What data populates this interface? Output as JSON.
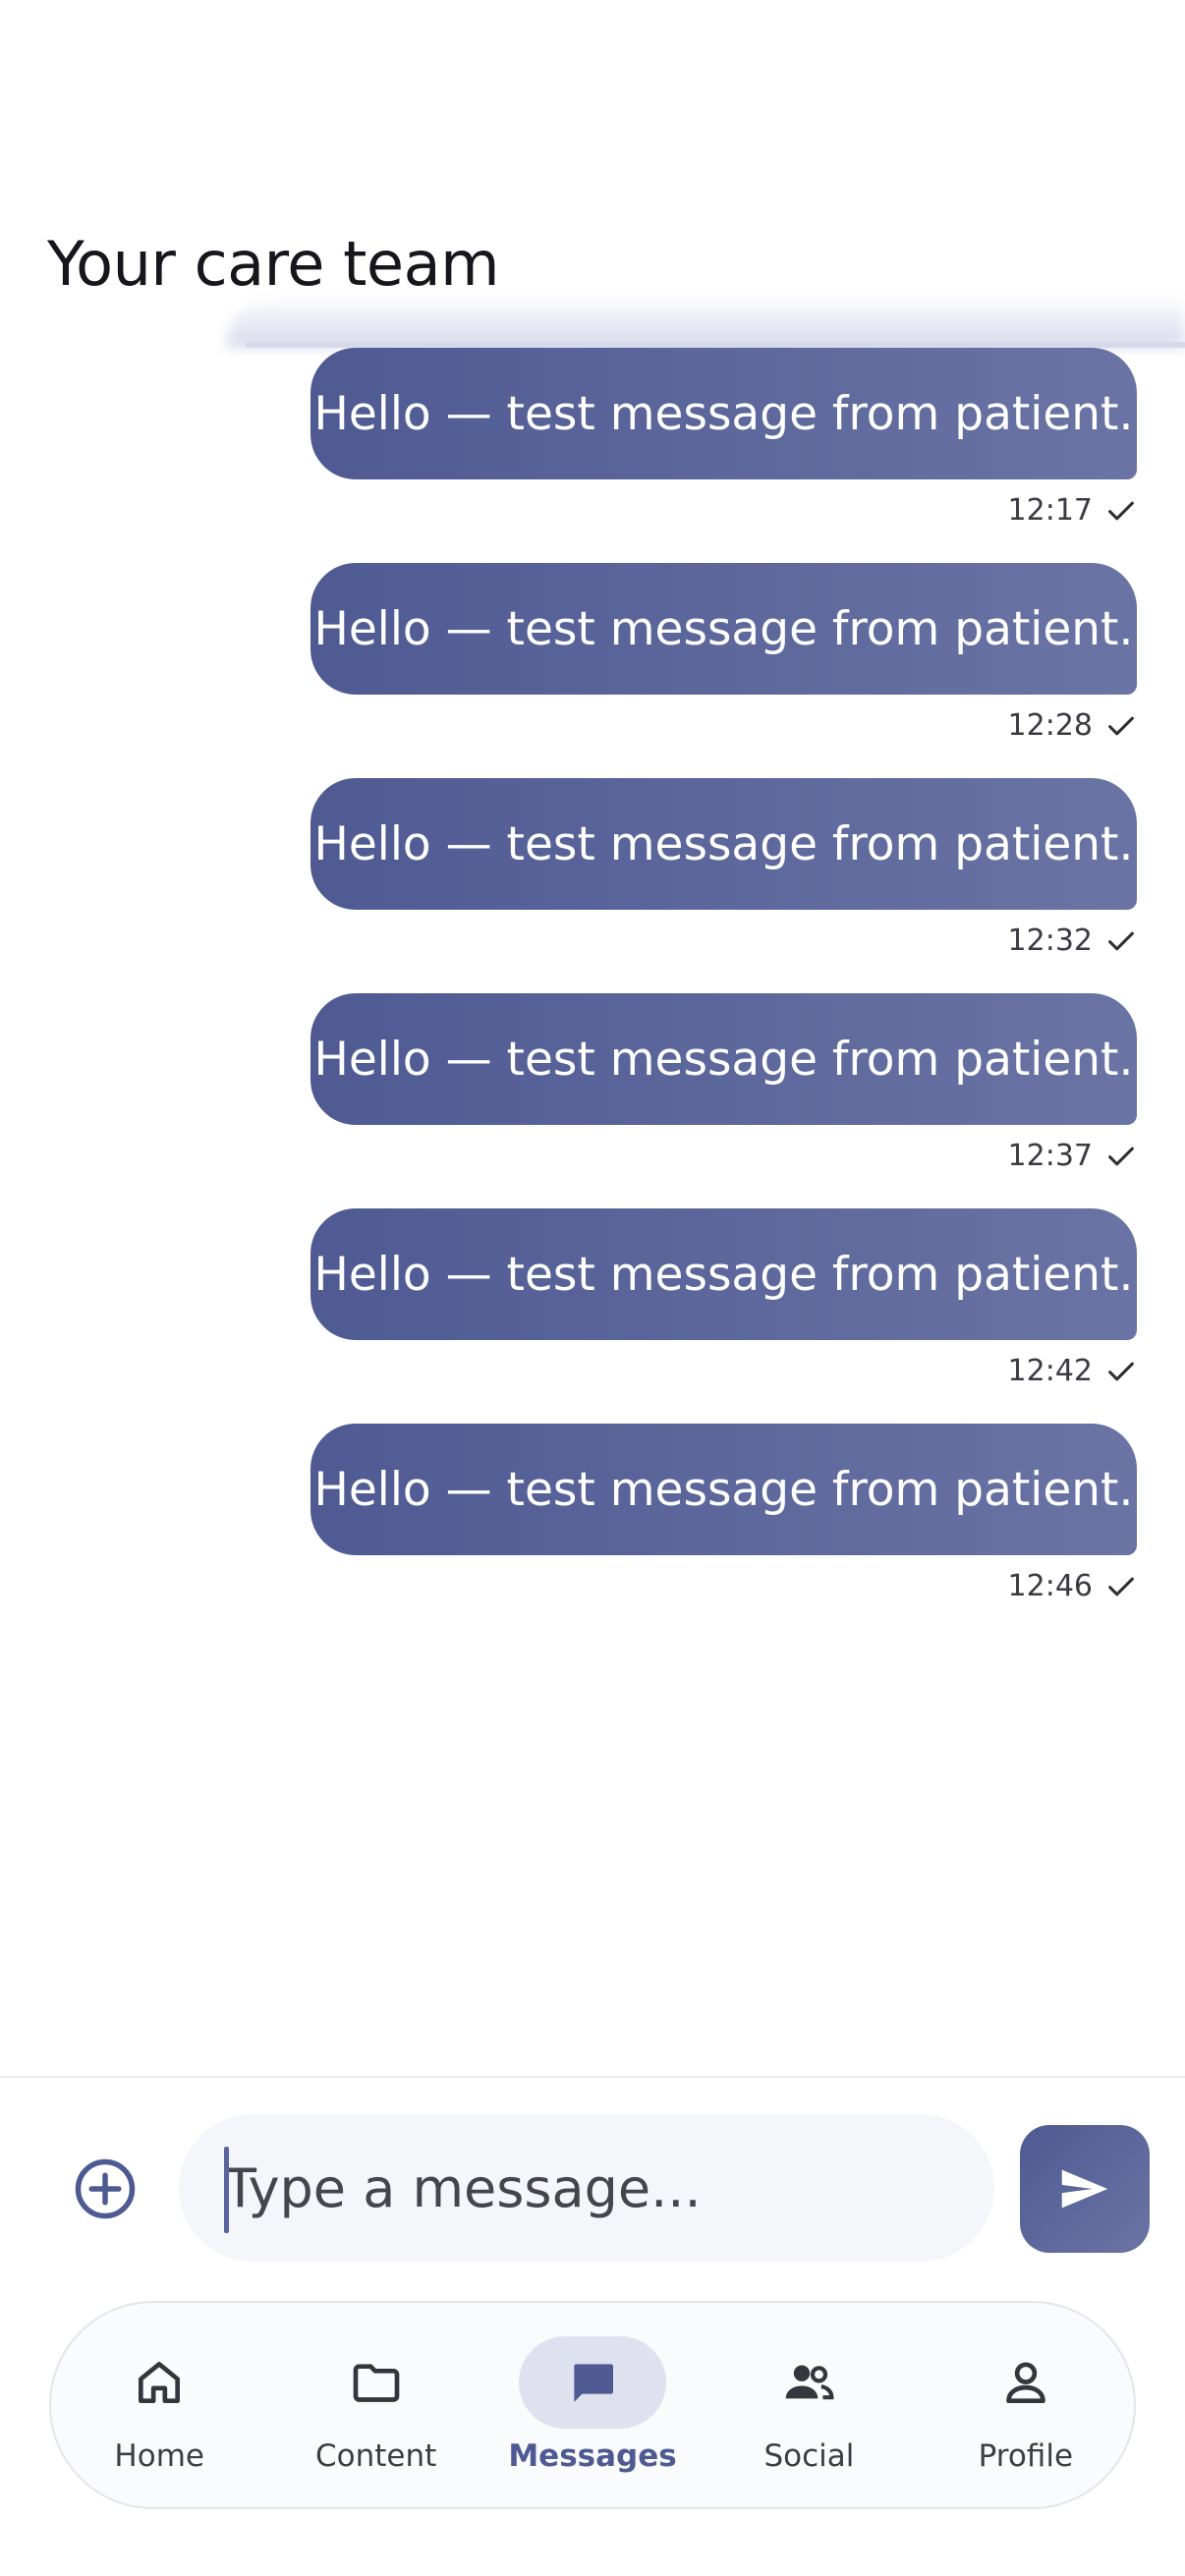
{
  "header": {
    "title": "Your care team"
  },
  "messages": [
    {
      "text": "Hello — test message from patient.",
      "time": "12:17"
    },
    {
      "text": "Hello — test message from patient.",
      "time": "12:28"
    },
    {
      "text": "Hello — test message from patient.",
      "time": "12:32"
    },
    {
      "text": "Hello — test message from patient.",
      "time": "12:37"
    },
    {
      "text": "Hello — test message from patient.",
      "time": "12:42"
    },
    {
      "text": "Hello — test message from patient.",
      "time": "12:46"
    }
  ],
  "composer": {
    "placeholder": "Type a message...",
    "attach_icon": "plus-circle-icon",
    "send_icon": "send-icon"
  },
  "nav": {
    "items": [
      {
        "label": "Home",
        "icon": "home-icon"
      },
      {
        "label": "Content",
        "icon": "folder-icon"
      },
      {
        "label": "Messages",
        "icon": "chat-icon",
        "active": true
      },
      {
        "label": "Social",
        "icon": "people-icon"
      },
      {
        "label": "Profile",
        "icon": "person-icon"
      }
    ]
  },
  "colors": {
    "accent": "#4F5A93",
    "accent_light": "#6A74A4",
    "active_pill": "#DFE1EF"
  }
}
